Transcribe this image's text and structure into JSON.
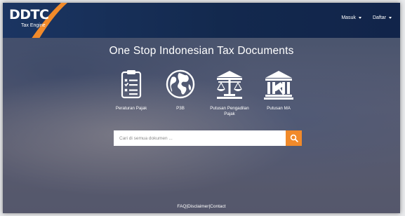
{
  "brand": {
    "logo_text": "DDTC",
    "logo_subtitle": "Tax Engine",
    "accent_color": "#f18a2a",
    "navbar_color": "#1b3562"
  },
  "nav": {
    "login_label": "Masuk",
    "register_label": "Daftar"
  },
  "hero": {
    "headline": "One Stop Indonesian Tax Documents"
  },
  "categories": [
    {
      "label": "Peraturan Pajak",
      "icon": "regulation-clipboard-icon"
    },
    {
      "label": "P3B",
      "icon": "globe-icon"
    },
    {
      "label": "Putusan Pengadilan Pajak",
      "icon": "tax-court-scales-icon"
    },
    {
      "label": "Putusan MA",
      "icon": "supreme-court-gavel-icon"
    }
  ],
  "search": {
    "placeholder": "Cari di semua dokumen ...",
    "value": ""
  },
  "footer": {
    "faq": "FAQ",
    "sep1": "|",
    "disclaimer": "Disclaimer",
    "sep2": "|",
    "contact": "Contact"
  }
}
